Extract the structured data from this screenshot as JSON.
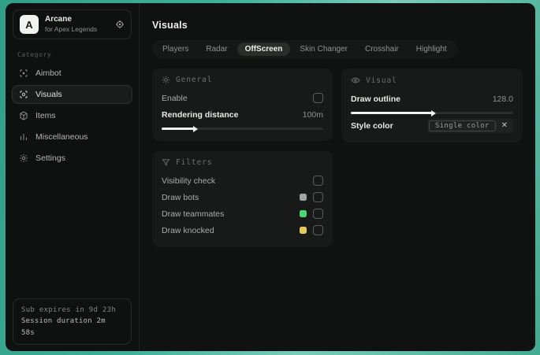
{
  "app": {
    "logo_letter": "A",
    "name": "Arcane",
    "subtitle": "for Apex Legends"
  },
  "sidebar": {
    "category_label": "Category",
    "items": [
      {
        "label": "Aimbot",
        "icon": "crosshair",
        "selected": false
      },
      {
        "label": "Visuals",
        "icon": "scan-eye",
        "selected": true
      },
      {
        "label": "Items",
        "icon": "cube",
        "selected": false
      },
      {
        "label": "Miscellaneous",
        "icon": "bars",
        "selected": false
      },
      {
        "label": "Settings",
        "icon": "gear",
        "selected": false
      }
    ],
    "footer": {
      "sub_expires": "Sub expires in 9d 23h",
      "session_duration": "Session duration 2m 58s"
    }
  },
  "header": {
    "title": "Visuals"
  },
  "tabs": [
    {
      "label": "Players",
      "selected": false
    },
    {
      "label": "Radar",
      "selected": false
    },
    {
      "label": "OffScreen",
      "selected": true
    },
    {
      "label": "Skin Changer",
      "selected": false
    },
    {
      "label": "Crosshair",
      "selected": false
    },
    {
      "label": "Highlight",
      "selected": false
    }
  ],
  "panels": {
    "general": {
      "title": "General",
      "icon": "sun",
      "enable_label": "Enable",
      "enable_checked": false,
      "distance_label": "Rendering distance",
      "distance_value": "100m",
      "distance_percent": 20
    },
    "filters": {
      "title": "Filters",
      "icon": "funnel",
      "rows": [
        {
          "label": "Visibility check",
          "swatch": null,
          "checked": false
        },
        {
          "label": "Draw bots",
          "swatch": "#a0a5a8",
          "checked": false
        },
        {
          "label": "Draw teammates",
          "swatch": "#4cd673",
          "checked": false
        },
        {
          "label": "Draw knocked",
          "swatch": "#e2c95f",
          "checked": false
        }
      ]
    },
    "visual": {
      "title": "Visual",
      "icon": "eye",
      "outline_label": "Draw outline",
      "outline_value": "128.0",
      "outline_percent": 50,
      "style_color_label": "Style color",
      "style_color_value": "Single color",
      "remove_glyph": "✕"
    }
  },
  "colors": {
    "accent_background": "#3fb098",
    "window_background": "#0d0f0e",
    "panel_background": "#181a19"
  }
}
